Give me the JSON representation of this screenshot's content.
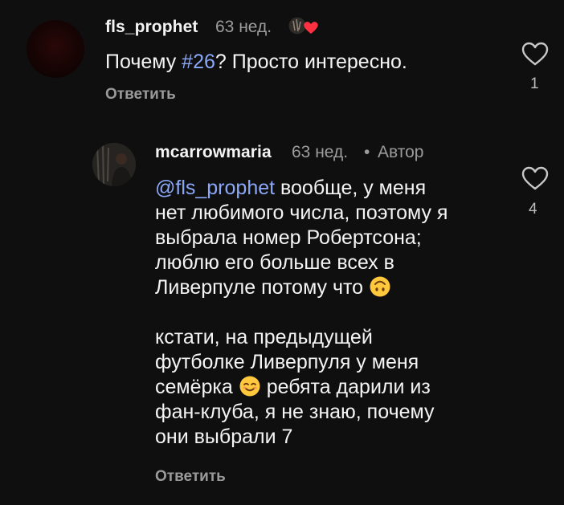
{
  "comments": [
    {
      "username": "fls_prophet",
      "time": "63 нед.",
      "text_before_tag": "Почему ",
      "hashtag": "#26",
      "text_after_tag": "? Просто интересно.",
      "reply_label": "Ответить",
      "like_count": "1",
      "avatar_icon": "avatar-fls-prophet"
    },
    {
      "username": "mcarrowmaria",
      "time": "63 нед.",
      "separator": "•",
      "author_label": "Автор",
      "mention": "@fls_prophet",
      "lines_p1": [
        " вообще, у меня",
        "нет любимого числа, поэтому я",
        "выбрала номер Робертсона;",
        "люблю его больше всех в",
        "Ливерпуле потому что "
      ],
      "lines_p2_a": "кстати, на предыдущей",
      "lines_p2_b": "футболке Ливерпуля у меня",
      "lines_p2_c1": "семёрка ",
      "lines_p2_c2": " ребята дарили из",
      "lines_p2_d": "фан-клуба, я не знаю, почему",
      "lines_p2_e": "они выбрали 7",
      "reply_label": "Ответить",
      "like_count": "4",
      "avatar_icon": "avatar-mcarrowmaria"
    }
  ],
  "icons": {
    "like": "heart-outline-icon",
    "creator_liked": "creator-liked-badge-icon",
    "emoji_upside_down": "upside-down-face-emoji",
    "emoji_smiling": "smiling-face-emoji"
  },
  "colors": {
    "background": "#0f0f10",
    "link": "#8aa8f7",
    "muted": "#9c9c9c",
    "heart_red": "#ff3040",
    "emoji_yellow": "#ffc83d"
  }
}
